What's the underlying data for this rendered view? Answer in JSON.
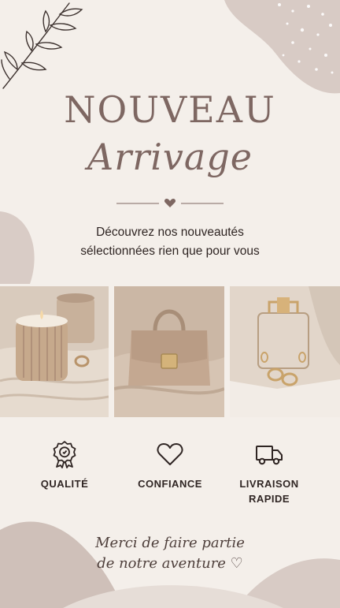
{
  "colors": {
    "background": "#f4efea",
    "blob": "#d8cbc5",
    "accent": "#7e6762",
    "text": "#2f2523"
  },
  "header": {
    "title": "NOUVEAU",
    "subtitle": "Arrivage"
  },
  "intro": {
    "line1": "Découvrez nos nouveautés",
    "line2": "sélectionnées rien que pour vous"
  },
  "photos": [
    {
      "icon": "candle-photo"
    },
    {
      "icon": "handbag-photo"
    },
    {
      "icon": "jewelry-photo"
    }
  ],
  "features": [
    {
      "icon": "award-badge-icon",
      "label": "QUALITÉ"
    },
    {
      "icon": "heart-outline-icon",
      "label": "CONFIANCE"
    },
    {
      "icon": "delivery-truck-icon",
      "label_line1": "LIVRAISON",
      "label_line2": "RAPIDE"
    }
  ],
  "footer": {
    "line1": "Merci de faire partie",
    "line2": "de notre aventure ♡"
  }
}
